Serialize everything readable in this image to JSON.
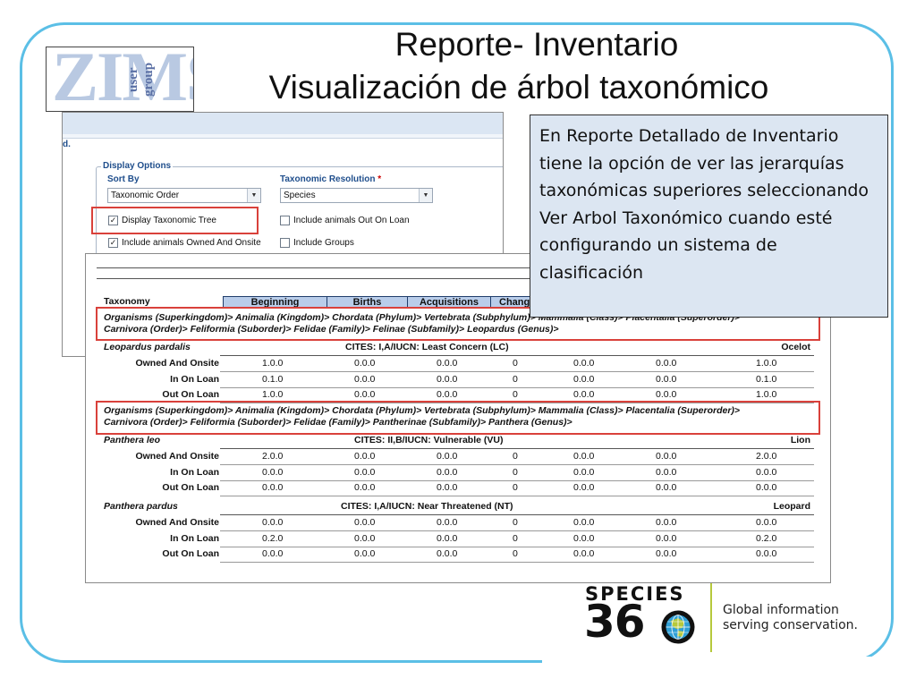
{
  "slide": {
    "title_line1": "Reporte- Inventario",
    "title_line2": "Visualización de árbol taxonómico",
    "callout": "En Reporte Detallado de Inventario tiene la opción de ver las jerarquías taxonómicas superiores seleccionando Ver Arbol Taxonómico cuando esté configurando un sistema de clasificación",
    "frame_color": "#5bbfe6",
    "highlight_color": "#d9413b"
  },
  "zims_logo": {
    "letters": "ZIMS",
    "subtitle": "user group"
  },
  "display_options": {
    "partial_label": "d.",
    "legend": "Display Options",
    "sort_by_label": "Sort By",
    "sort_by_value": "Taxonomic Order",
    "resolution_label": "Taxonomic Resolution",
    "required_mark": "*",
    "resolution_value": "Species",
    "checkboxes": [
      {
        "label": "Display Taxonomic Tree",
        "checked": true
      },
      {
        "label": "Include animals Out On Loan",
        "checked": false
      },
      {
        "label": "Include animals Owned And Onsite",
        "checked": true
      },
      {
        "label": "Include Groups",
        "checked": false
      }
    ],
    "checked_glyph": "✓"
  },
  "report": {
    "taxonomy_label": "Taxonomy",
    "columns": [
      "Beginning",
      "Births",
      "Acquisitions",
      "Chang"
    ],
    "groups": [
      {
        "path_line1": "Organisms (Superkingdom)> Animalia (Kingdom)> Chordata (Phylum)> Vertebrata (Subphylum)> Mammalia (Class)> Placentalia (Superorder)>",
        "path_line2": "Carnivora (Order)> Feliformia (Suborder)> Felidae (Family)> Felinae (Subfamily)> Leopardus (Genus)>",
        "species": "Leopardus pardalis",
        "cites": "CITES: I,A/IUCN: Least Concern (LC)",
        "common": "Ocelot",
        "rows": [
          {
            "label": "Owned And Onsite",
            "values": [
              "1.0.0",
              "0.0.0",
              "0.0.0",
              "0",
              "0.0.0",
              "0.0.0",
              "1.0.0"
            ]
          },
          {
            "label": "In On Loan",
            "values": [
              "0.1.0",
              "0.0.0",
              "0.0.0",
              "0",
              "0.0.0",
              "0.0.0",
              "0.1.0"
            ]
          },
          {
            "label": "Out On Loan",
            "values": [
              "1.0.0",
              "0.0.0",
              "0.0.0",
              "0",
              "0.0.0",
              "0.0.0",
              "1.0.0"
            ]
          }
        ]
      },
      {
        "path_line1": "Organisms (Superkingdom)> Animalia (Kingdom)> Chordata (Phylum)> Vertebrata (Subphylum)> Mammalia (Class)> Placentalia (Superorder)>",
        "path_line2": "Carnivora (Order)> Feliformia (Suborder)> Felidae (Family)> Pantherinae (Subfamily)> Panthera (Genus)>",
        "species": "Panthera leo",
        "cites": "CITES: II,B/IUCN: Vulnerable (VU)",
        "common": "Lion",
        "rows": [
          {
            "label": "Owned And Onsite",
            "values": [
              "2.0.0",
              "0.0.0",
              "0.0.0",
              "0",
              "0.0.0",
              "0.0.0",
              "2.0.0"
            ]
          },
          {
            "label": "In On Loan",
            "values": [
              "0.0.0",
              "0.0.0",
              "0.0.0",
              "0",
              "0.0.0",
              "0.0.0",
              "0.0.0"
            ]
          },
          {
            "label": "Out On Loan",
            "values": [
              "0.0.0",
              "0.0.0",
              "0.0.0",
              "0",
              "0.0.0",
              "0.0.0",
              "0.0.0"
            ]
          }
        ]
      },
      {
        "species": "Panthera pardus",
        "cites": "CITES: I,A/IUCN: Near Threatened (NT)",
        "common": "Leopard",
        "rows": [
          {
            "label": "Owned And Onsite",
            "values": [
              "0.0.0",
              "0.0.0",
              "0.0.0",
              "0",
              "0.0.0",
              "0.0.0",
              "0.0.0"
            ]
          },
          {
            "label": "In On Loan",
            "values": [
              "0.2.0",
              "0.0.0",
              "0.0.0",
              "0",
              "0.0.0",
              "0.0.0",
              "0.2.0"
            ]
          },
          {
            "label": "Out On Loan",
            "values": [
              "0.0.0",
              "0.0.0",
              "0.0.0",
              "0",
              "0.0.0",
              "0.0.0",
              "0.0.0"
            ]
          }
        ]
      }
    ]
  },
  "species360": {
    "word": "SPECIES",
    "number": "36",
    "tagline_line1": "Global information",
    "tagline_line2": "serving conservation.",
    "accent_color": "#b6c93c"
  }
}
